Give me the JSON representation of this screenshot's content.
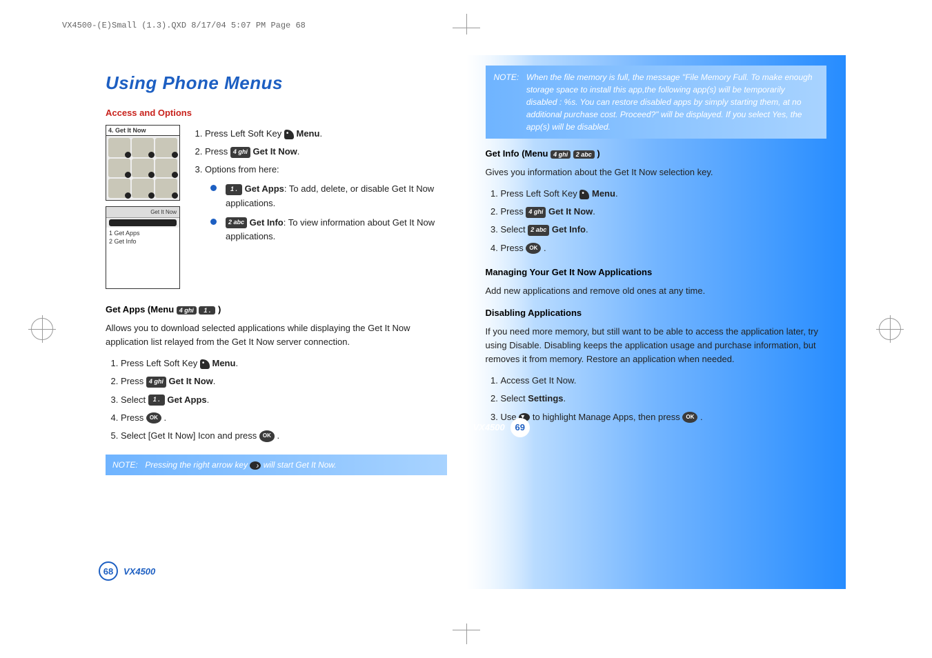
{
  "meta": {
    "header_line": "VX4500-(E)Small (1.3).QXD  8/17/04  5:07 PM  Page 68"
  },
  "left": {
    "title": "Using Phone Menus",
    "section1": "Access and Options",
    "screen1_title": "4. Get It Now",
    "screen2_top": "Get It Now",
    "screen2_item1": "1 Get Apps",
    "screen2_item2": "2 Get Info",
    "steps1": {
      "s1a": "Press Left Soft Key ",
      "s1b": " Menu",
      "s2a": "Press ",
      "s2k": "4 ghi",
      "s2b": " Get It Now",
      "s3": "Options from here:",
      "b1k": "1 .",
      "b1a": " Get Apps",
      "b1b": ": To add, delete, or disable Get It Now applications.",
      "b2k": "2 abc",
      "b2a": " Get Info",
      "b2b": ": To view information about Get It Now applications."
    },
    "section2a": "Get Apps (Menu ",
    "section2k1": "4 ghi",
    "section2k2": "1 .",
    "section2b": " )",
    "para1": "Allows you to download selected applications while displaying the Get It Now application list relayed from the Get It Now server connection.",
    "steps2": {
      "s1a": "Press Left Soft Key ",
      "s1b": " Menu",
      "s2a": "Press ",
      "s2k": "4 ghi",
      "s2b": " Get It Now",
      "s3a": "Select ",
      "s3k": "1 .",
      "s3b": " Get Apps",
      "s4a": "Press ",
      "s4b": " .",
      "s5a": "Select [Get It Now] Icon and press ",
      "s5b": " ."
    },
    "note1_label": "NOTE:",
    "note1_text_a": "Pressing the right arrow key ",
    "note1_text_b": " will start Get It Now.",
    "footer_model": "VX4500",
    "footer_page": "68"
  },
  "right": {
    "note_label": "NOTE:",
    "note_text": "When the file memory is full, the message \"File Memory Full. To make enough storage space to install this app,the following app(s) will be temporarily disabled : %s. You can restore disabled apps by simply starting them, at no additional purchase cost. Proceed?\" will be displayed. If you select Yes, the app(s) will be disabled.",
    "section1a": "Get Info (Menu ",
    "section1k1": "4 ghi",
    "section1k2": "2 abc",
    "section1b": " )",
    "para1": "Gives you information about the Get It Now selection key.",
    "steps1": {
      "s1a": "Press Left Soft Key ",
      "s1b": " Menu",
      "s2a": "Press ",
      "s2k": "4 ghi",
      "s2b": " Get It Now",
      "s3a": "Select ",
      "s3k": "2 abc",
      "s3b": " Get Info",
      "s4a": "Press ",
      "s4b": " ."
    },
    "section2": "Managing Your Get It Now Applications",
    "para2": "Add new applications and remove old ones at any time.",
    "section3": "Disabling Applications",
    "para3": "If you need more memory, but still want to be able to access the application later, try using Disable. Disabling keeps the application usage and purchase information, but removes it from memory. Restore an application when needed.",
    "steps2": {
      "s1": "Access Get It Now.",
      "s2a": "Select ",
      "s2b": "Settings",
      "s3a": "Use ",
      "s3b": " to highlight Manage Apps, then press ",
      "s3c": " ."
    },
    "footer_model": "VX4500",
    "footer_page": "69"
  }
}
